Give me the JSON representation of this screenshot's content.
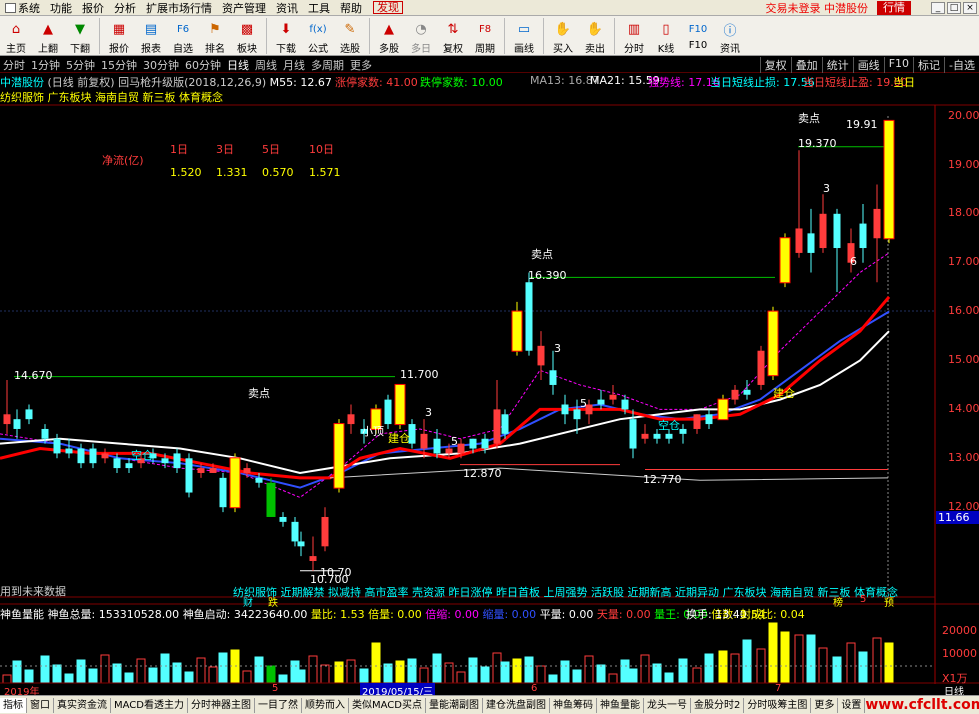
{
  "menu": {
    "items": [
      "系统",
      "功能",
      "报价",
      "分析",
      "扩展市场行情",
      "资产管理",
      "资讯",
      "工具",
      "帮助"
    ],
    "discover": "发现",
    "trade": "交易未登录 中潜股份",
    "market": "行情"
  },
  "toolbar": {
    "buttons": [
      "主页",
      "上翻",
      "下翻",
      "报价",
      "报表",
      "自选",
      "排名",
      "板块",
      "下载",
      "公式",
      "选股",
      "多股",
      "多日",
      "复权",
      "周期",
      "画线",
      "买入",
      "卖出",
      "分时",
      "K线",
      "F10",
      "资讯"
    ]
  },
  "periods": {
    "items": [
      "分时",
      "1分钟",
      "5分钟",
      "15分钟",
      "30分钟",
      "60分钟",
      "日线",
      "周线",
      "月线",
      "多周期",
      "更多"
    ],
    "active": "日线",
    "right": [
      "复权",
      "叠加",
      "统计",
      "画线",
      "F10",
      "标记",
      "-自选"
    ]
  },
  "info": {
    "stock": "中潜股份",
    "mode": "(日线 前复权)",
    "indicator": "回马枪升级版(2018,12,26,9)",
    "ma55": "M55: 12.67",
    "up_count": "涨停家数: 41.00",
    "down_count": "跌停家数: 10.00",
    "ma13": "MA13: 16.87",
    "ma21": "MA21: 15.59",
    "strong": "强势线: 17.16",
    "stop_loss": "当日短线止损: 17.56",
    "stop_profit": "当日短线止盈: 19.00",
    "extra": "当日",
    "sectors": "纺织服饰 广东板块 海南自贸 新三板 体育概念"
  },
  "netflow": {
    "label": "净流(亿)",
    "headers": [
      "1日",
      "3日",
      "5日",
      "10日"
    ],
    "values": [
      "1.520",
      "1.331",
      "0.570",
      "1.571"
    ]
  },
  "annotations": {
    "sell": "卖点",
    "build": "建仓",
    "empty": "空仓",
    "small_top": "小顶",
    "p14670": "14.670",
    "p11700": "11.700",
    "p16390": "16.390",
    "p19370": "19.370",
    "p19910": "19.91",
    "p12870": "12.870",
    "p12770": "12.770",
    "p10700a": "10.70",
    "p10700b": "10.700",
    "n3": "3",
    "n5": "5",
    "n6": "6",
    "future": "用到未来数据",
    "cai": "财",
    "zhang": "跌",
    "pu": "榜",
    "fu": "5",
    "yu": "预"
  },
  "sector_tags": "纺织服饰 近期解禁 拟减持 高市盈率 壳资源 昨日涨停 昨日首板 上周强势 活跃股 近期新高 近期异动 广东板块 海南自贸 新三板 体育概念",
  "axis": {
    "labels": [
      "20.00",
      "19.00",
      "18.00",
      "17.00",
      "16.00",
      "15.00",
      "14.00",
      "13.00",
      "12.00"
    ],
    "current": "11.66",
    "vol_labels": [
      "20000",
      "10000",
      "X1万"
    ]
  },
  "volume": {
    "name": "神鱼量能",
    "total": "神鱼总量: 153310528.00",
    "start": "神鱼启动: 34223640.00",
    "ratio": "量比: 1.53",
    "double": "倍量: 0.00",
    "dual": "倍缩: 0.00",
    "shrink": "缩量: 0.00",
    "flat": "平量: 0.00",
    "sky": "天量: 0.00",
    "king": "量王: 0.00",
    "times": "倍数: 1.54",
    "turnover": "换手: 13.40",
    "deal": "封成比: 0.04"
  },
  "timeline": {
    "y2019": "2019年",
    "date": "2019/05/15/三",
    "m5": "5",
    "m6": "6",
    "m7": "7",
    "daily": "日线"
  },
  "tabs": [
    "指标",
    "窗口",
    "真实资金流",
    "MACD看透主力",
    "分时神器主图",
    "一目了然",
    "顺势而入",
    "类似MACD买点",
    "量能潮副图",
    "建仓洗盘副图",
    "神鱼筹码",
    "神鱼量能",
    "龙头一号",
    "金股分时2",
    "分时吸筹主图",
    "更多",
    "设置"
  ],
  "watermark": "www.cfcllt.com",
  "colors": {
    "up": "#ff3c3c",
    "down": "#54ffff",
    "ma": "#ff0000",
    "white": "#ffffff",
    "yellow": "#ffff00",
    "green": "#00c000",
    "magenta": "#ff00ff",
    "blue": "#3050ff"
  }
}
